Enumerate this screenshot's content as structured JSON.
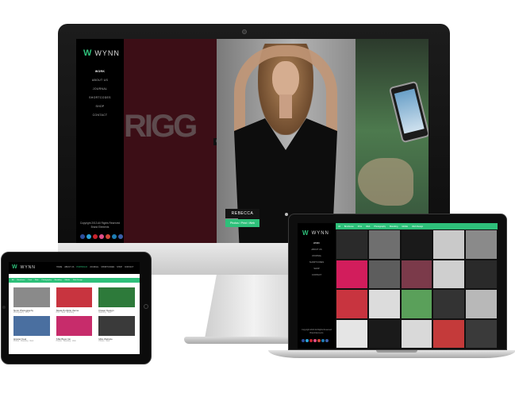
{
  "brand": {
    "logo_mark": "W",
    "name": "WYNN",
    "accent": "#2ec07a"
  },
  "imac": {
    "nav": [
      "WORK",
      "ABOUT US",
      "JOURNAL",
      "SHORTCODES",
      "SHOP",
      "CONTACT"
    ],
    "active_nav": "WORK",
    "copyright_line1": "Copyright 2013 All Rights Reserved",
    "copyright_line2": "Brand Elements",
    "panel_text": "RIGG",
    "arrow": "›",
    "project_name": "REBECCA",
    "project_tags": "Photos / Print / Web"
  },
  "macbook": {
    "nav": [
      "WORK",
      "ABOUT US",
      "JOURNAL",
      "SHORTCODES",
      "SHOP",
      "CONTACT"
    ],
    "filters": [
      "All",
      "Brochures",
      "Print",
      "Web",
      "Photography",
      "Branding",
      "Mobile",
      "Web Design"
    ],
    "tiles": [
      "#2a2a2a",
      "#6f6f6f",
      "#1a1a1a",
      "#c9c9c9",
      "#8a8a8a",
      "#d21d5c",
      "#5d5d5d",
      "#7b3a4a",
      "#cfcfcf",
      "#2a2a2a",
      "#c8343f",
      "#dcdcdc",
      "#5aa05a",
      "#333333",
      "#b8b8b8",
      "#e5e5e5",
      "#1a1a1a",
      "#d9d9d9",
      "#c43a3a",
      "#3a3a3a"
    ]
  },
  "ipad": {
    "nav": [
      "HOME",
      "ABOUT US",
      "PORTFOLIO",
      "JOURNAL",
      "SHORTCODES",
      "SHOP",
      "CONTACT"
    ],
    "filters": [
      "All",
      "Brochures",
      "Print",
      "Web",
      "Photography",
      "Branding",
      "Mobile",
      "Web Design"
    ],
    "items": [
      {
        "title": "Nunn Photography",
        "sub": "Photography · Print",
        "color": "#8a8a8a"
      },
      {
        "title": "Skata Portfolio theme",
        "sub": "Print · Web · Branding",
        "color": "#c8343f"
      },
      {
        "title": "Flower Design",
        "sub": "Branding · Web",
        "color": "#2d7a3a"
      },
      {
        "title": "Hipster Feel",
        "sub": "Photos · Branding · Web",
        "color": "#4a6fa0"
      },
      {
        "title": "T&E Brew Inn",
        "sub": "Photos · Branding · Web",
        "color": "#c72c6b"
      },
      {
        "title": "Mira Website",
        "sub": "Photos · Web",
        "color": "#3a3a3a"
      }
    ]
  }
}
